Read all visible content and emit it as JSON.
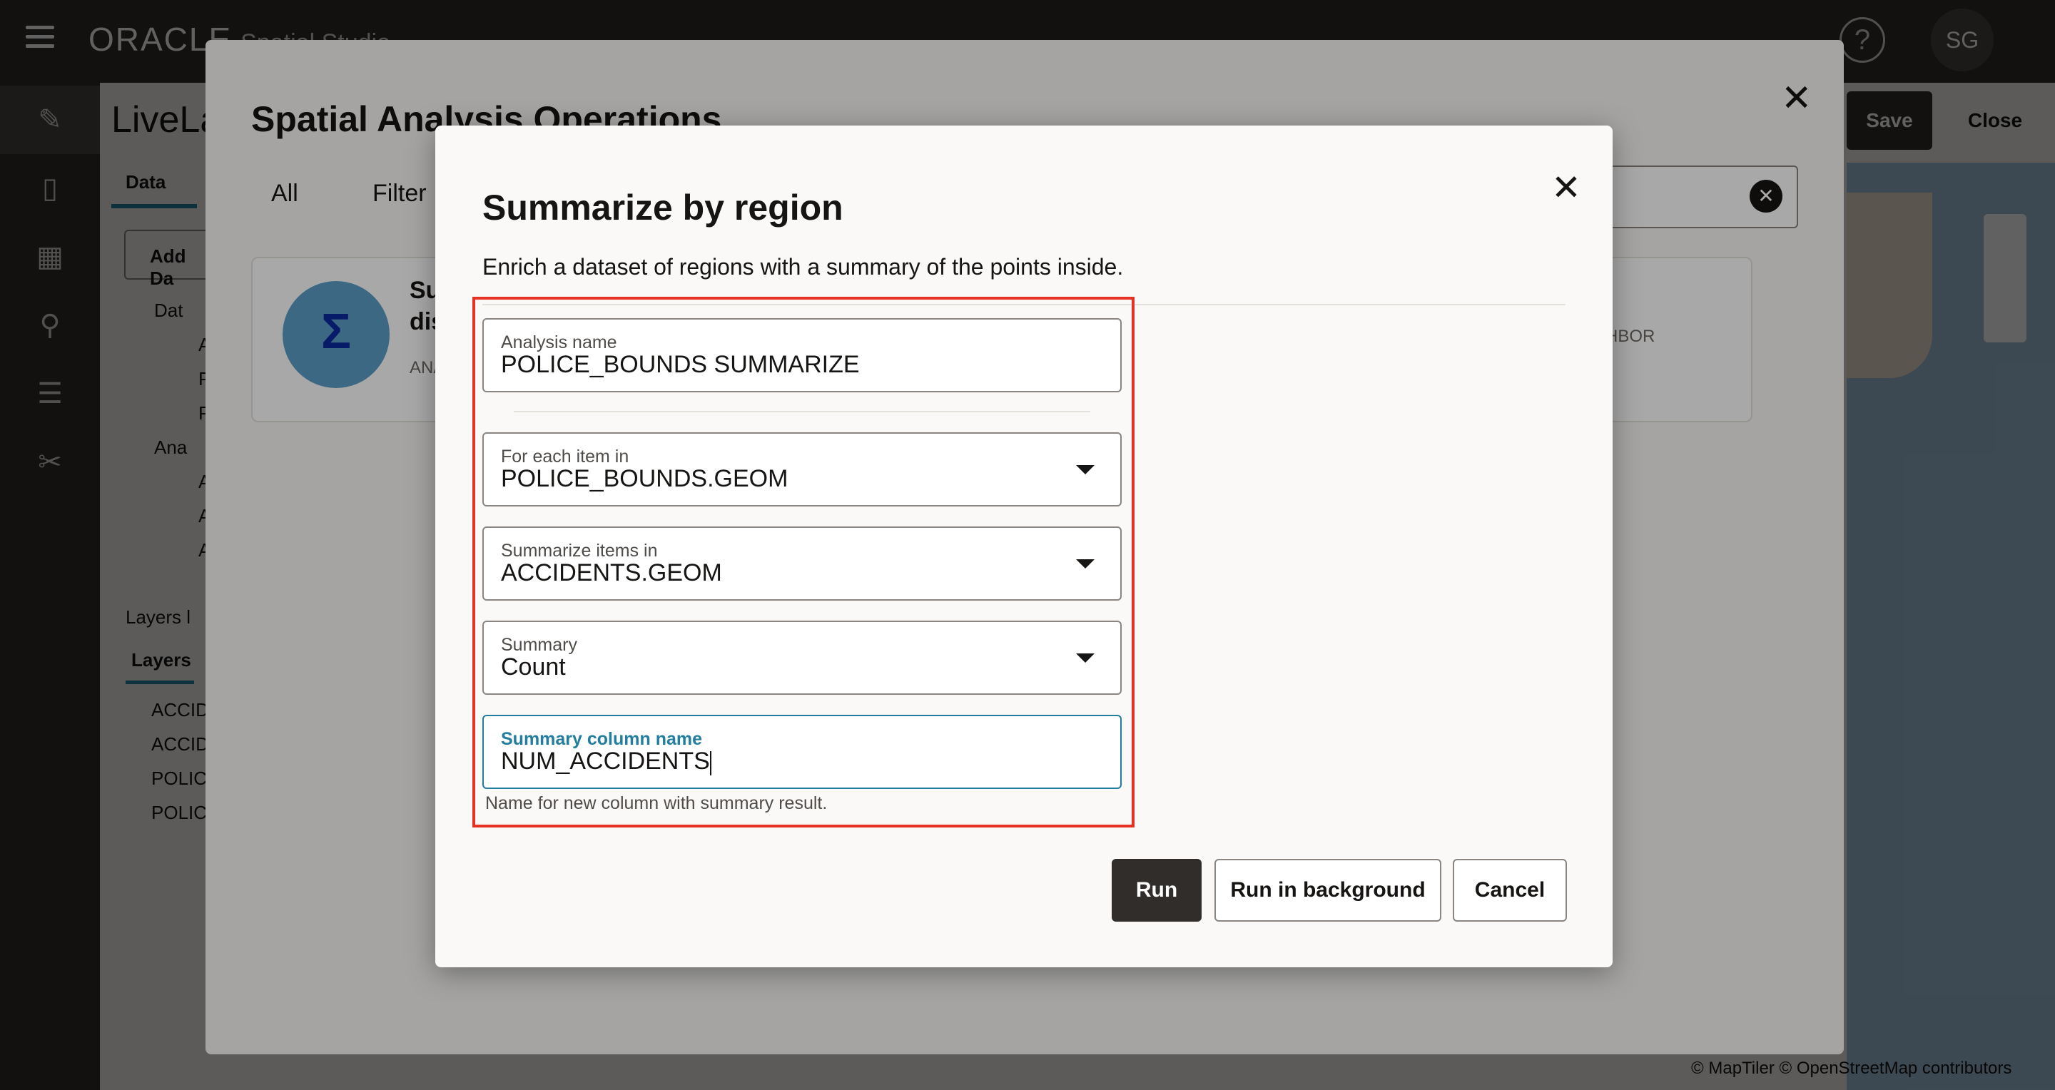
{
  "app": {
    "brand": "ORACLE",
    "product": "Spatial Studio",
    "user_initials": "SG",
    "help_icon": "question-circle-icon"
  },
  "project": {
    "title": "LiveLa",
    "data_tab": "Data",
    "add_data_label": "Add Da",
    "save_label": "Save",
    "close_label": "Close",
    "layers_tab": "Layers",
    "layers_header": "Layers l",
    "tree_items": [
      "Dat",
      "A",
      "P",
      "P",
      "Ana",
      "A",
      "A",
      "A"
    ],
    "layer_items": [
      "ACCIDI",
      "ACCIDI",
      "POLICE",
      "POLICE"
    ]
  },
  "map": {
    "attribution": "© MapTiler  © OpenStreetMap contributors"
  },
  "operations_dialog": {
    "title": "Spatial Analysis Operations",
    "tabs": [
      "All",
      "Filter"
    ],
    "card_title": "Su",
    "card_title_2": "dis",
    "card_category": "ANA",
    "card_neighbor_text": "HBOR"
  },
  "summarize_dialog": {
    "title": "Summarize by region",
    "description": "Enrich a dataset of regions with a summary of the points inside.",
    "analysis_name": {
      "label": "Analysis name",
      "value": "POLICE_BOUNDS SUMMARIZE"
    },
    "for_each": {
      "label": "For each item in",
      "value": "POLICE_BOUNDS.GEOM"
    },
    "summarize_items": {
      "label": "Summarize items in",
      "value": "ACCIDENTS.GEOM"
    },
    "summary": {
      "label": "Summary",
      "value": "Count"
    },
    "summary_column": {
      "label": "Summary column name",
      "value": "NUM_ACCIDENTS",
      "help": "Name for new column with summary result."
    },
    "buttons": {
      "run": "Run",
      "run_background": "Run in background",
      "cancel": "Cancel"
    }
  },
  "colors": {
    "highlight": "#e53222",
    "accent": "#227e9e",
    "primary_button": "#312d2a"
  }
}
